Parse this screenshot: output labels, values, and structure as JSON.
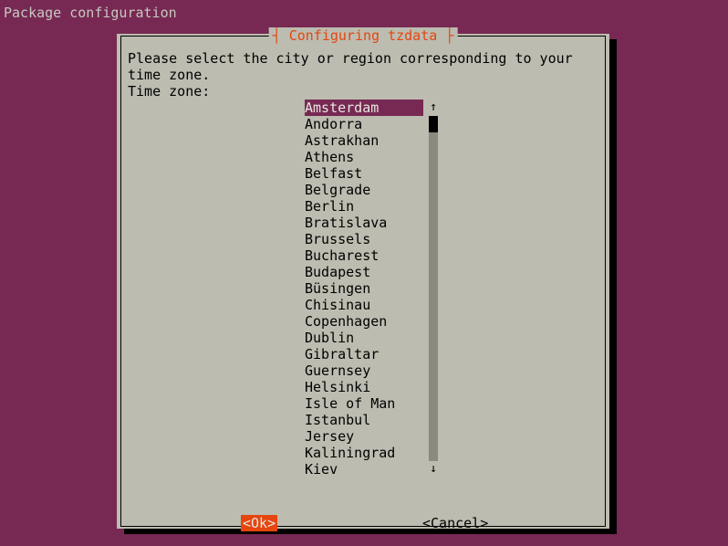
{
  "header": "Package configuration",
  "dialog": {
    "title": "┤ Configuring tzdata ├",
    "instruction": "Please select the city or region corresponding to your time zone.",
    "prompt": "Time zone:",
    "selected_index": 0,
    "items": [
      "Amsterdam",
      "Andorra",
      "Astrakhan",
      "Athens",
      "Belfast",
      "Belgrade",
      "Berlin",
      "Bratislava",
      "Brussels",
      "Bucharest",
      "Budapest",
      "Büsingen",
      "Chisinau",
      "Copenhagen",
      "Dublin",
      "Gibraltar",
      "Guernsey",
      "Helsinki",
      "Isle of Man",
      "Istanbul",
      "Jersey",
      "Kaliningrad",
      "Kiev"
    ],
    "ok_label": "<Ok>",
    "cancel_label": "<Cancel>"
  },
  "scrollbar": {
    "up": "↑",
    "down": "↓"
  }
}
